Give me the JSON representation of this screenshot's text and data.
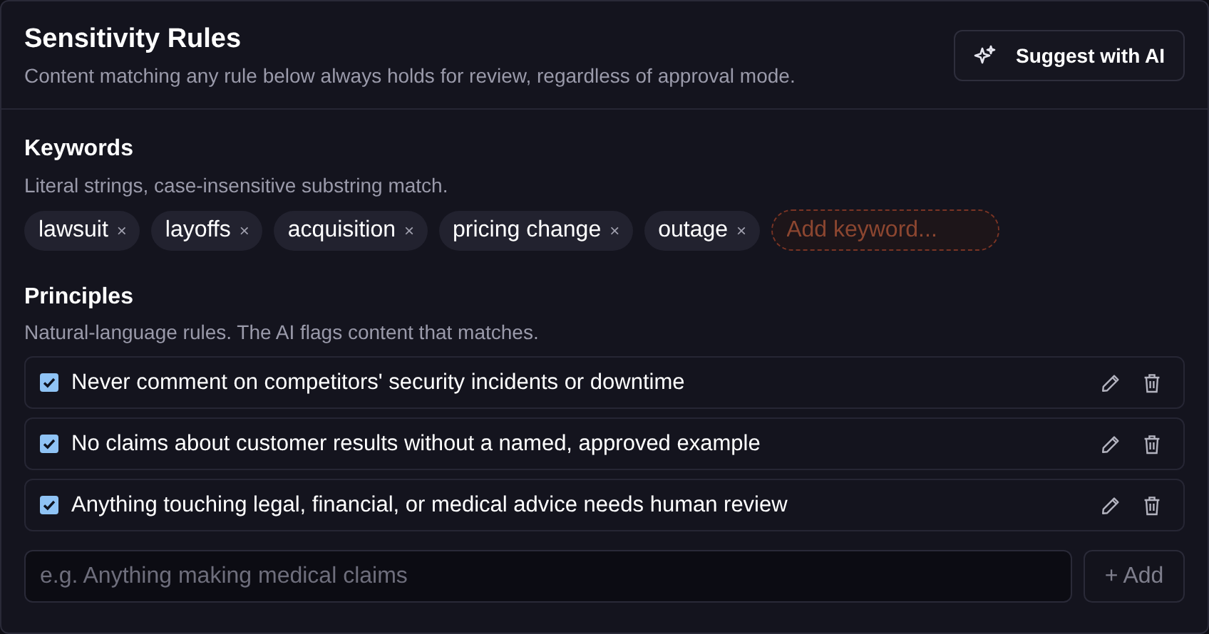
{
  "header": {
    "title": "Sensitivity Rules",
    "subtitle": "Content matching any rule below always holds for review, regardless of approval mode.",
    "suggest_button": "Suggest with AI"
  },
  "keywords": {
    "title": "Keywords",
    "description": "Literal strings, case-insensitive substring match.",
    "chips": [
      {
        "label": "lawsuit",
        "remove": "×"
      },
      {
        "label": "layoffs",
        "remove": "×"
      },
      {
        "label": "acquisition",
        "remove": "×"
      },
      {
        "label": "pricing change",
        "remove": "×"
      },
      {
        "label": "outage",
        "remove": "×"
      }
    ],
    "add_field": {
      "placeholder": "Add keyword..."
    }
  },
  "principles": {
    "title": "Principles",
    "description": "Natural-language rules. The AI flags content that matches.",
    "items": [
      {
        "text": "Never comment on competitors' security incidents or downtime",
        "checked": true
      },
      {
        "text": "No claims about customer results without a named, approved example",
        "checked": true
      },
      {
        "text": "Anything touching legal, financial, or medical advice needs human review",
        "checked": true
      }
    ],
    "new_field": {
      "placeholder": "e.g. Anything making medical claims"
    },
    "add_button": "+ Add"
  }
}
